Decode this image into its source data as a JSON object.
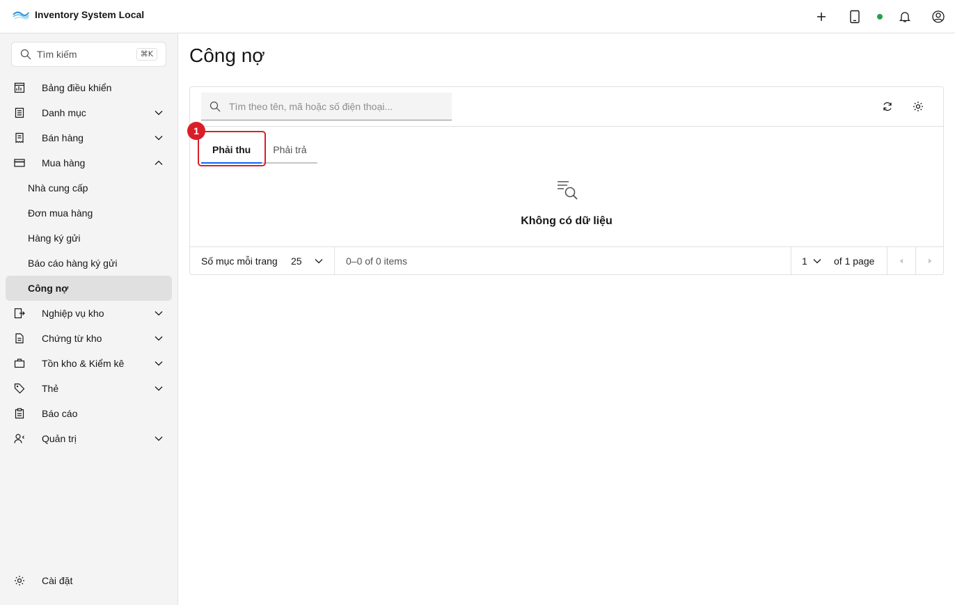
{
  "header": {
    "app_title": "Inventory System Local",
    "icons": [
      "plus-icon",
      "tablet-icon",
      "status-dot",
      "notification-icon",
      "user-icon"
    ],
    "status_color": "#24a148"
  },
  "sidebar": {
    "search_placeholder": "Tìm kiếm",
    "search_shortcut": "⌘K",
    "items": [
      {
        "label": "Bảng điều khiển"
      },
      {
        "label": "Danh mục"
      },
      {
        "label": "Bán hàng"
      },
      {
        "label": "Mua hàng"
      },
      {
        "label": "Nghiệp vụ kho"
      },
      {
        "label": "Chứng từ kho"
      },
      {
        "label": "Tồn kho & Kiểm kê"
      },
      {
        "label": "Thẻ"
      },
      {
        "label": "Báo cáo"
      },
      {
        "label": "Quản trị"
      }
    ],
    "purchase_sub_items": [
      {
        "label": "Nhà cung cấp"
      },
      {
        "label": "Đơn mua hàng"
      },
      {
        "label": "Hàng ký gửi"
      },
      {
        "label": "Báo cáo hàng ký gửi"
      },
      {
        "label": "Công nợ"
      }
    ],
    "settings_label": "Cài đặt"
  },
  "main": {
    "page_title": "Công nợ",
    "search_placeholder": "Tìm theo tên, mã hoặc số điện thoại...",
    "tabs": [
      {
        "label": "Phải thu"
      },
      {
        "label": "Phải trả"
      }
    ],
    "annotation_badge": "1",
    "empty_text": "Không có dữ liệu",
    "pagination": {
      "items_per_page_label": "Số mục mỗi trang",
      "items_per_page": "25",
      "range_text": "0–0 of 0 items",
      "current_page": "1",
      "of_pages": "of 1 page"
    }
  },
  "colors": {
    "accent": "#0f62fe",
    "highlight": "#da1e28",
    "sidebar_bg": "#f4f4f4",
    "active_item_bg": "#e0e0e0"
  }
}
